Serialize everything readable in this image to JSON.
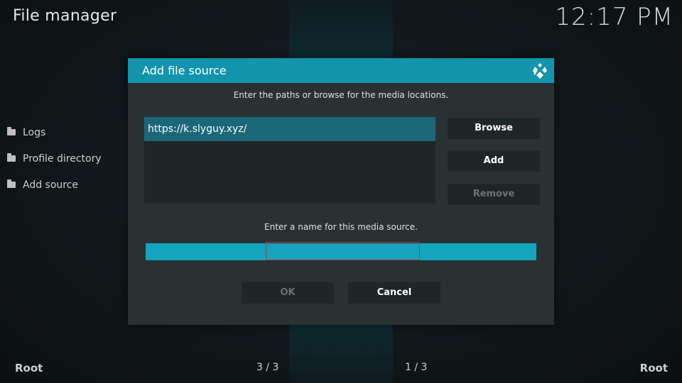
{
  "header": {
    "title": "File manager",
    "clock": "12:17 PM"
  },
  "sidebar": {
    "items": [
      {
        "label": "Logs"
      },
      {
        "label": "Profile directory"
      },
      {
        "label": "Add source"
      }
    ]
  },
  "footer": {
    "left_label": "Root",
    "left_count": "3 / 3",
    "right_count": "1 / 3",
    "right_label": "Root"
  },
  "dialog": {
    "title": "Add file source",
    "paths_instruction": "Enter the paths or browse for the media locations.",
    "paths": [
      "https://k.slyguy.xyz/"
    ],
    "browse_label": "Browse",
    "add_label": "Add",
    "remove_label": "Remove",
    "name_instruction": "Enter a name for this media source.",
    "name_value": "",
    "ok_label": "OK",
    "cancel_label": "Cancel"
  },
  "colors": {
    "accent": "#1294ac",
    "selection": "#1a6778",
    "focus_border": "#c0353a",
    "dialog_bg": "#293133"
  }
}
